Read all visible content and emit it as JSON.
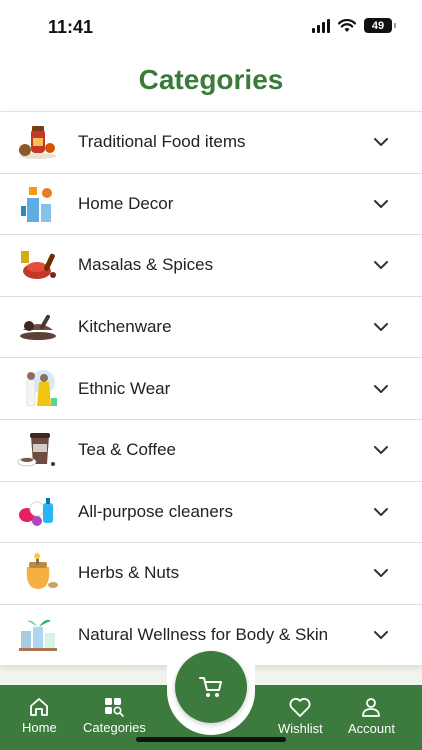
{
  "status_bar": {
    "time": "11:41",
    "battery": "49"
  },
  "page": {
    "title": "Categories"
  },
  "categories": [
    {
      "label": "Traditional Food items",
      "icon": "pickle-jar-icon"
    },
    {
      "label": "Home Decor",
      "icon": "home-decor-icon"
    },
    {
      "label": "Masalas & Spices",
      "icon": "spices-icon"
    },
    {
      "label": "Kitchenware",
      "icon": "kitchenware-icon"
    },
    {
      "label": "Ethnic Wear",
      "icon": "ethnic-wear-icon"
    },
    {
      "label": "Tea & Coffee",
      "icon": "coffee-cup-icon"
    },
    {
      "label": "All-purpose cleaners",
      "icon": "cleaners-icon"
    },
    {
      "label": "Herbs & Nuts",
      "icon": "honey-jar-icon"
    },
    {
      "label": "Natural Wellness for Body & Skin",
      "icon": "wellness-icon"
    }
  ],
  "bottom_nav": {
    "home": "Home",
    "categories": "Categories",
    "wishlist": "Wishlist",
    "account": "Account"
  },
  "colors": {
    "accent": "#3d7a3d",
    "title": "#3a7a3a"
  }
}
